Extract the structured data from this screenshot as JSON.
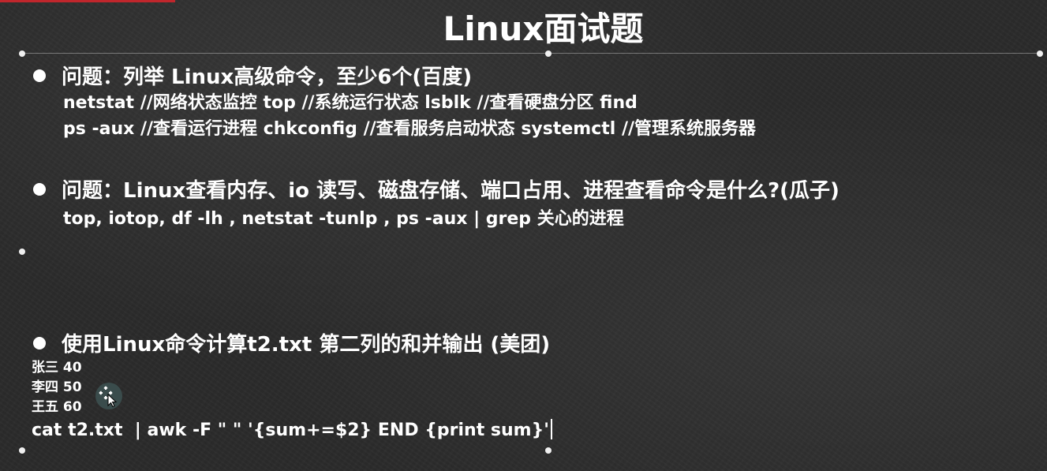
{
  "slide": {
    "title": "Linux面试题",
    "items": [
      {
        "question": "问题：列举 Linux高级命令，至少6个(百度)",
        "answers": [
          "netstat //网络状态监控 top //系统运行状态 lsblk //查看硬盘分区 find",
          "ps -aux //查看运行进程 chkconfig //查看服务启动状态 systemctl //管理系统服务器"
        ]
      },
      {
        "question": "问题：Linux查看内存、io 读写、磁盘存储、端口占用、进程查看命令是什么?(瓜子)",
        "answers": [
          "top, iotop, df -lh , netstat -tunlp , ps -aux | grep 关心的进程"
        ]
      },
      {
        "question": "使用Linux命令计算t2.txt 第二列的和并输出 (美团)",
        "data_rows": [
          "张三 40",
          "李四 50",
          "王五 60"
        ],
        "command": "cat t2.txt  | awk -F \" \" '{sum+=$2} END {print sum}'"
      }
    ]
  },
  "colors": {
    "background": "#2b2b2b",
    "text": "#ffffff",
    "top_mark": "#c0262c"
  },
  "icons": {
    "cursor": "move-cursor-icon"
  }
}
